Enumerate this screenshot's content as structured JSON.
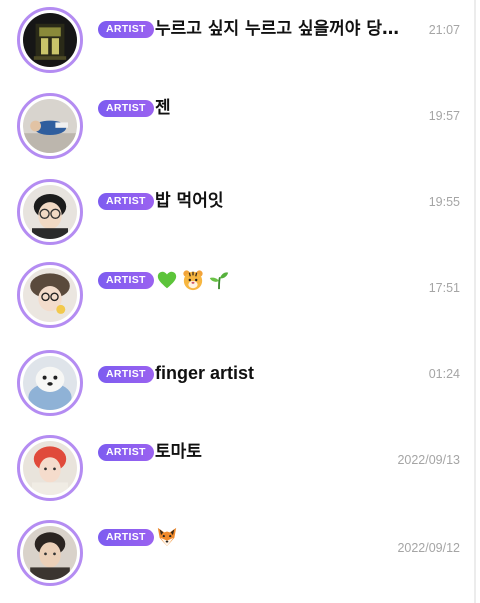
{
  "colors": {
    "badge_start": "#7d5cf0",
    "badge_end": "#9a62f0",
    "avatar_ring": "#b48cf2",
    "message_text": "#111111",
    "time_text": "#a5a5a5"
  },
  "chats": [
    {
      "badge": "ARTIST",
      "message": "누르고 싶지 누르고 싶을꺼야 당…",
      "time": "21:07",
      "avatar": "album-cover-avatar"
    },
    {
      "badge": "ARTIST",
      "message": "젠",
      "time": "19:57",
      "avatar": "person-lying-avatar"
    },
    {
      "badge": "ARTIST",
      "message": "밥 먹어잇",
      "time": "19:55",
      "avatar": "person-glasses-avatar"
    },
    {
      "badge": "ARTIST",
      "message": "",
      "emojis": [
        "green-heart-icon",
        "tiger-face-icon",
        "seedling-icon"
      ],
      "time": "17:51",
      "avatar": "person-hat-avatar"
    },
    {
      "badge": "ARTIST",
      "message": "finger artist",
      "time": "01:24",
      "avatar": "dog-avatar"
    },
    {
      "badge": "ARTIST",
      "message": "토마토",
      "time": "2022/09/13",
      "avatar": "red-hair-avatar"
    },
    {
      "badge": "ARTIST",
      "message": "",
      "emojis": [
        "fox-face-icon"
      ],
      "time": "2022/09/12",
      "avatar": "person-portrait-avatar"
    }
  ]
}
